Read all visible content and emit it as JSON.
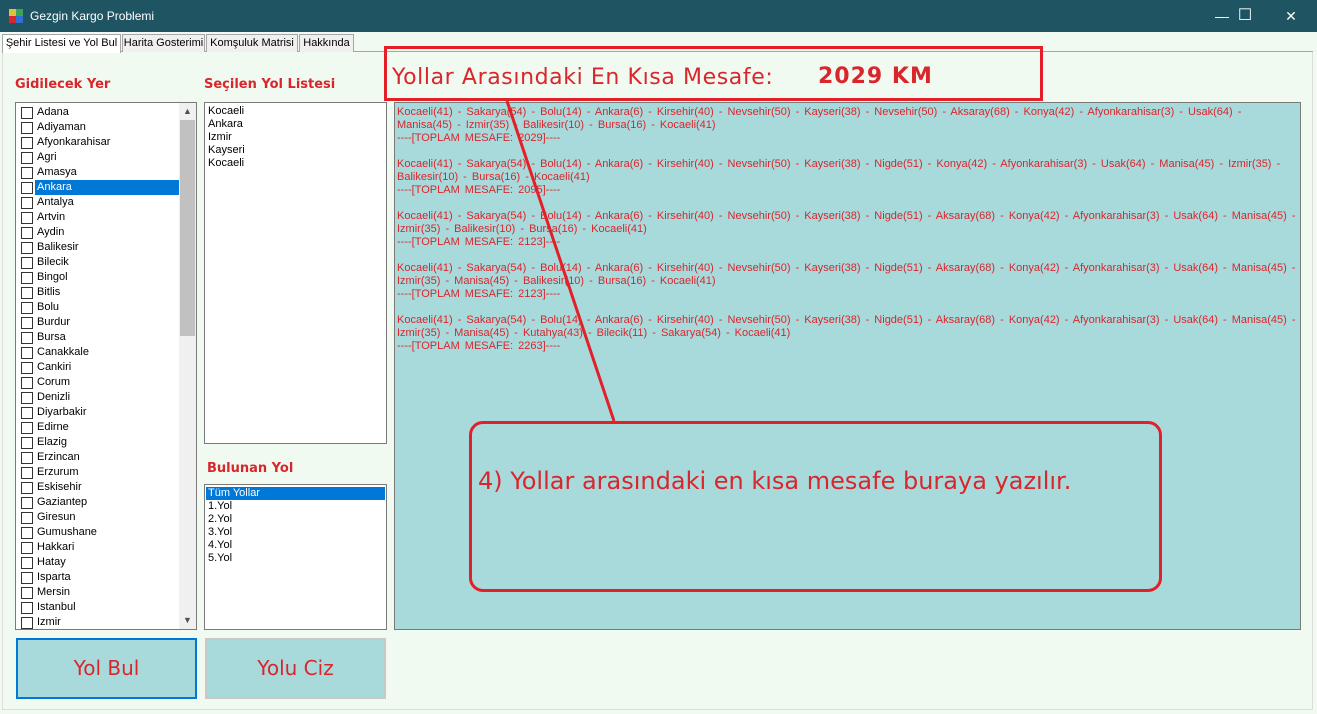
{
  "window": {
    "title": "Gezgin Kargo Problemi",
    "minimize_glyph": "—",
    "maximize_glyph": "☐",
    "close_glyph": "✕"
  },
  "tabs": [
    {
      "label": "Şehir Listesi ve Yol Bul",
      "active": true
    },
    {
      "label": "Harita Gosterimi"
    },
    {
      "label": "Komşuluk Matrisi"
    },
    {
      "label": "Hakkında"
    }
  ],
  "city_panel": {
    "heading": "Gidilecek Yer",
    "cities": [
      "Adana",
      "Adiyaman",
      "Afyonkarahisar",
      "Agri",
      "Amasya",
      "Ankara",
      "Antalya",
      "Artvin",
      "Aydin",
      "Balikesir",
      "Bilecik",
      "Bingol",
      "Bitlis",
      "Bolu",
      "Burdur",
      "Bursa",
      "Canakkale",
      "Cankiri",
      "Corum",
      "Denizli",
      "Diyarbakir",
      "Edirne",
      "Elazig",
      "Erzincan",
      "Erzurum",
      "Eskisehir",
      "Gaziantep",
      "Giresun",
      "Gumushane",
      "Hakkari",
      "Hatay",
      "Isparta",
      "Mersin",
      "Istanbul",
      "Izmir"
    ],
    "selected": "Ankara",
    "scroll_up": "▲",
    "scroll_down": "▼"
  },
  "selected_route": {
    "heading": "Seçilen Yol Listesi",
    "items": [
      "Kocaeli",
      "Ankara",
      "Izmir",
      "Kayseri",
      "Kocaeli"
    ]
  },
  "found_route": {
    "heading": "Bulunan Yol",
    "items": [
      "Tüm Yollar",
      "1.Yol",
      "2.Yol",
      "3.Yol",
      "4.Yol",
      "5.Yol"
    ],
    "selected": "Tüm Yollar"
  },
  "buttons": {
    "find": "Yol Bul",
    "draw": "Yolu Ciz"
  },
  "shortest": {
    "label": "Yollar Arasındaki En Kısa Mesafe:",
    "value": "2029 KM"
  },
  "results": [
    {
      "path": "Kocaeli(41)  - Sakarya(54) - Bolu(14) - Ankara(6) - Kirsehir(40) - Nevsehir(50) - Kayseri(38) - Nevsehir(50) - Aksaray(68) - Konya(42) - Afyonkarahisar(3) - Usak(64) - Manisa(45) - Izmir(35) - Balikesir(10) - Bursa(16) - Kocaeli(41)",
      "total": "----[TOPLAM MESAFE: 2029]----"
    },
    {
      "path": "Kocaeli(41)  - Sakarya(54) - Bolu(14) - Ankara(6) - Kirsehir(40) - Nevsehir(50) - Kayseri(38) - Nigde(51) - Konya(42) - Afyonkarahisar(3) - Usak(64) - Manisa(45) - Izmir(35) - Balikesir(10) - Bursa(16) - Kocaeli(41)",
      "total": "----[TOPLAM MESAFE: 2095]----"
    },
    {
      "path": "Kocaeli(41)  - Sakarya(54) - Bolu(14) - Ankara(6) - Kirsehir(40) - Nevsehir(50) - Kayseri(38) - Nigde(51) - Aksaray(68) - Konya(42) - Afyonkarahisar(3) - Usak(64) - Manisa(45) - Izmir(35) - Balikesir(10) - Bursa(16) - Kocaeli(41)",
      "total": "----[TOPLAM MESAFE: 2123]----"
    },
    {
      "path": "Kocaeli(41)  - Sakarya(54) - Bolu(14) - Ankara(6) - Kirsehir(40) - Nevsehir(50) - Kayseri(38) - Nigde(51) - Aksaray(68) - Konya(42) - Afyonkarahisar(3) - Usak(64) - Manisa(45) - Izmir(35) - Manisa(45) - Balikesir(10) - Bursa(16) - Kocaeli(41)",
      "total": "----[TOPLAM MESAFE: 2123]----"
    },
    {
      "path": "Kocaeli(41)  - Sakarya(54) - Bolu(14) - Ankara(6) - Kirsehir(40) - Nevsehir(50) - Kayseri(38) - Nigde(51) - Aksaray(68) - Konya(42) - Afyonkarahisar(3) - Usak(64) - Manisa(45) - Izmir(35) - Manisa(45) - Kutahya(43) - Bilecik(11) - Sakarya(54) - Kocaeli(41)",
      "total": "----[TOPLAM MESAFE: 2263]----"
    }
  ],
  "annotation": {
    "note": "4) Yollar arasındaki en kısa mesafe buraya yazılır."
  },
  "colors": {
    "accent_red": "#d9262c",
    "panel_teal": "#a8dadc",
    "titlebar": "#1f5462",
    "selection_blue": "#0078d7"
  }
}
